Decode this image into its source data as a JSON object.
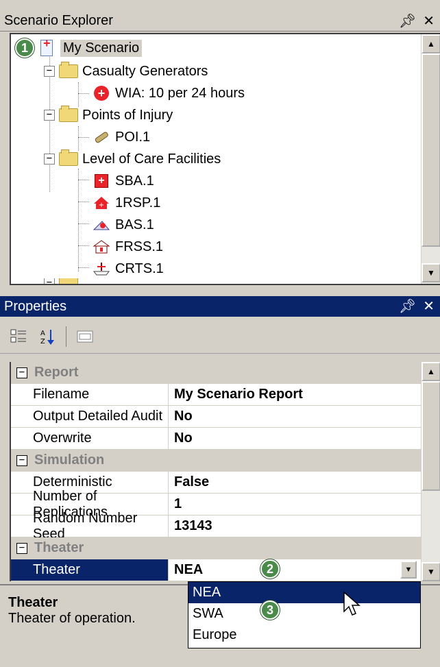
{
  "scenario_explorer": {
    "title": "Scenario Explorer",
    "pin": " Ԅ",
    "close": "✕",
    "tree": {
      "root": "My Scenario",
      "casualty_generators": "Casualty Generators",
      "wia": "WIA: 10 per 24 hours",
      "points_of_injury": "Points of Injury",
      "poi": "POI.1",
      "level_of_care": "Level of Care Facilities",
      "sba": "SBA.1",
      "rsp": "1RSP.1",
      "bas": "BAS.1",
      "frss": "FRSS.1",
      "crts": "CRTS.1"
    }
  },
  "properties": {
    "title": "Properties",
    "categories": {
      "report": "Report",
      "simulation": "Simulation",
      "theater": "Theater"
    },
    "rows": {
      "filename": {
        "name": "Filename",
        "value": "My Scenario Report"
      },
      "audit": {
        "name": "Output Detailed Audit",
        "value": "No"
      },
      "overwrite": {
        "name": "Overwrite",
        "value": "No"
      },
      "deterministic": {
        "name": "Deterministic",
        "value": "False"
      },
      "replications": {
        "name": "Number of Replications",
        "value": "1"
      },
      "seed": {
        "name": "Random Number Seed",
        "value": "13143"
      },
      "theater": {
        "name": "Theater",
        "value": "NEA"
      }
    },
    "dropdown_options": [
      "NEA",
      "SWA",
      "Europe"
    ],
    "description": {
      "title": "Theater",
      "text": "Theater of operation."
    }
  },
  "callouts": [
    "1",
    "2",
    "3"
  ],
  "colors": {
    "selection": "#0a246a",
    "callout": "#4a8a4a",
    "background": "#d4d0c8"
  }
}
